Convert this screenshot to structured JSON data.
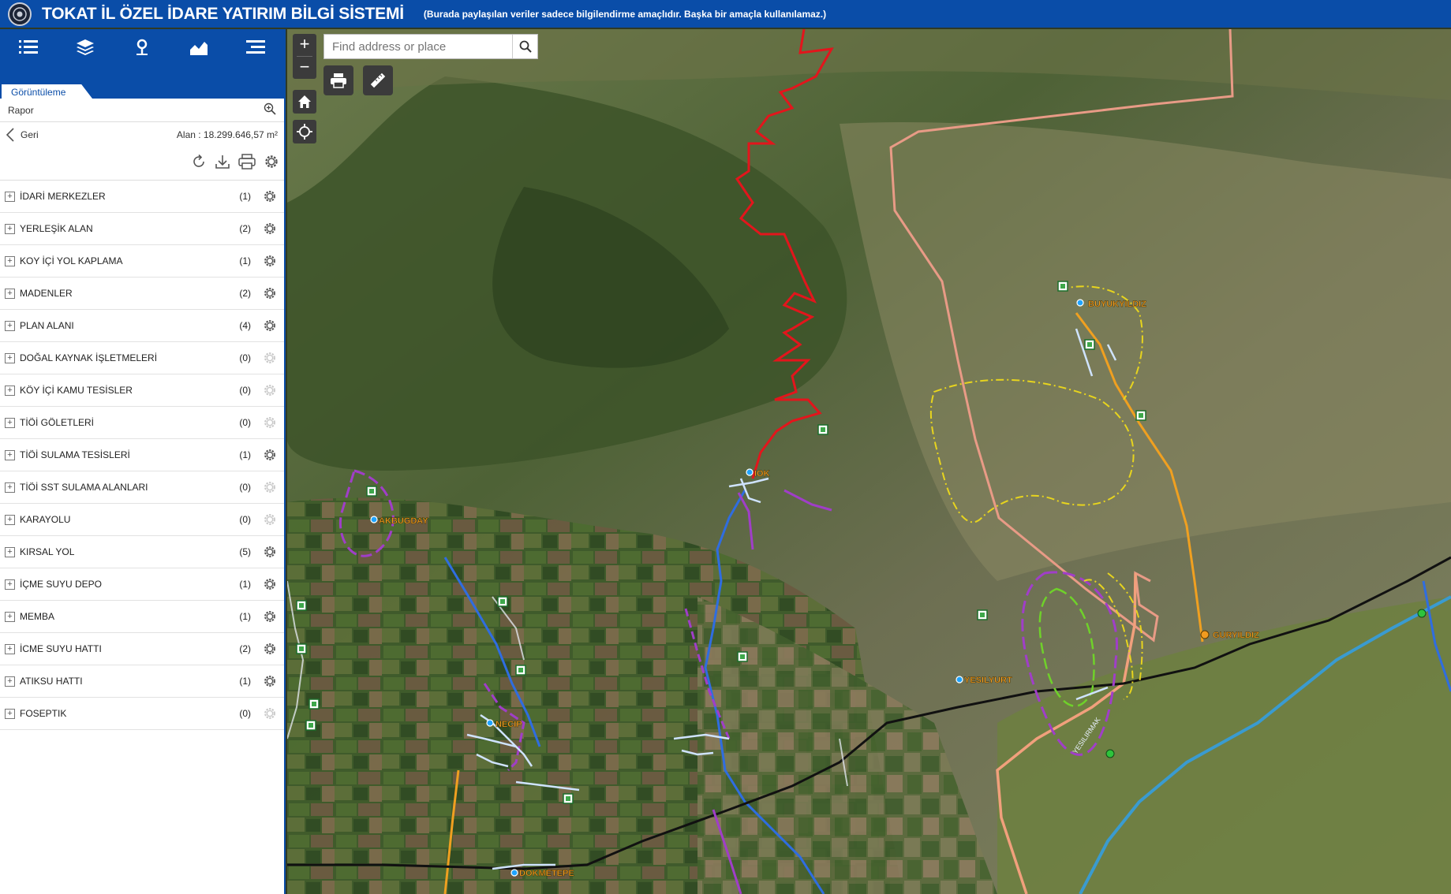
{
  "header": {
    "title": "TOKAT İL ÖZEL İDARE YATIRIM BİLGİ SİSTEMİ",
    "subtitle": "(Burada paylaşılan veriler sadece bilgilendirme amaçlıdır. Başka bir amaçla kullanılamaz.)"
  },
  "colors": {
    "brand": "#0a4da8",
    "control": "#3b3b3b"
  },
  "toolbar": {
    "icons": [
      "list-icon",
      "layers-icon",
      "location-pin-icon",
      "chart-icon",
      "menu-icon"
    ]
  },
  "panel": {
    "tab": "Görüntüleme",
    "report_label": "Rapor",
    "back_label": "Geri",
    "area_label": "Alan : 18.299.646,57 m²",
    "layers": [
      {
        "name": "İDARİ MERKEZLER",
        "count": "(1)",
        "active": true
      },
      {
        "name": "YERLEŞİK ALAN",
        "count": "(2)",
        "active": true
      },
      {
        "name": "KOY İÇİ YOL KAPLAMA",
        "count": "(1)",
        "active": true
      },
      {
        "name": "MADENLER",
        "count": "(2)",
        "active": true
      },
      {
        "name": "PLAN ALANI",
        "count": "(4)",
        "active": true
      },
      {
        "name": "DOĞAL KAYNAK İŞLETMELERİ",
        "count": "(0)",
        "active": false
      },
      {
        "name": "KÖY İÇİ KAMU TESİSLER",
        "count": "(0)",
        "active": false
      },
      {
        "name": "TİÖİ GÖLETLERİ",
        "count": "(0)",
        "active": false
      },
      {
        "name": "TİÖİ SULAMA TESİSLERİ",
        "count": "(1)",
        "active": true
      },
      {
        "name": "TİÖİ SST SULAMA ALANLARI",
        "count": "(0)",
        "active": false
      },
      {
        "name": "KARAYOLU",
        "count": "(0)",
        "active": false
      },
      {
        "name": "KIRSAL YOL",
        "count": "(5)",
        "active": true
      },
      {
        "name": "İÇME SUYU DEPO",
        "count": "(1)",
        "active": true
      },
      {
        "name": "MEMBA",
        "count": "(1)",
        "active": true
      },
      {
        "name": "İCME SUYU HATTI",
        "count": "(2)",
        "active": true
      },
      {
        "name": "ATIKSU HATTI",
        "count": "(1)",
        "active": true
      },
      {
        "name": "FOSEPTIK",
        "count": "(0)",
        "active": false
      }
    ]
  },
  "map": {
    "search_placeholder": "Find address or place",
    "zoom_in": "+",
    "zoom_out": "−",
    "places": [
      "BUYUKYILDIZ",
      "AKBUGDAY",
      "NECIP",
      "DOKMETEPE",
      "YESILYURT",
      "GURYILDIZ",
      "IOK"
    ],
    "river_label": "YESILIRMAK"
  }
}
